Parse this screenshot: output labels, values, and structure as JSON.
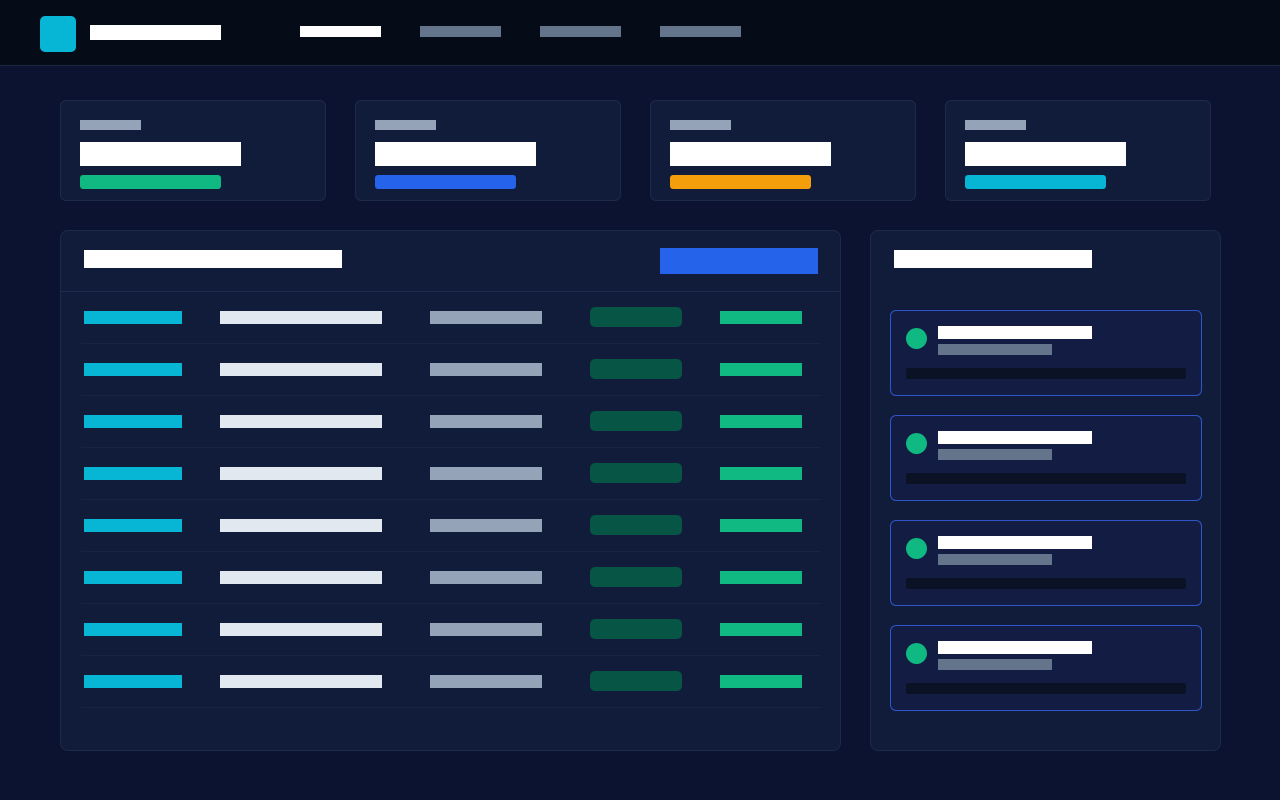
{
  "header": {
    "title": "",
    "nav": [
      {
        "label": ""
      },
      {
        "label": ""
      },
      {
        "label": ""
      },
      {
        "label": ""
      }
    ]
  },
  "colors": {
    "logo": "#06b6d4",
    "nav_inactive": "#64748b",
    "accent_green": "#10b981",
    "accent_blue": "#2563eb",
    "accent_orange": "#f59e0b",
    "accent_cyan": "#06b6d4"
  },
  "stats": [
    {
      "label": "",
      "value": "",
      "accent": "#10b981"
    },
    {
      "label": "",
      "value": "",
      "accent": "#2563eb"
    },
    {
      "label": "",
      "value": "",
      "accent": "#f59e0b"
    },
    {
      "label": "",
      "value": "",
      "accent": "#06b6d4"
    }
  ],
  "table": {
    "title": "",
    "action_label": "",
    "id_color": "#06b6d4",
    "amount_color": "#10b981",
    "rows": [
      {
        "id": "",
        "name": "",
        "meta": "",
        "status": "",
        "amount": ""
      },
      {
        "id": "",
        "name": "",
        "meta": "",
        "status": "",
        "amount": ""
      },
      {
        "id": "",
        "name": "",
        "meta": "",
        "status": "",
        "amount": ""
      },
      {
        "id": "",
        "name": "",
        "meta": "",
        "status": "",
        "amount": ""
      },
      {
        "id": "",
        "name": "",
        "meta": "",
        "status": "",
        "amount": ""
      },
      {
        "id": "",
        "name": "",
        "meta": "",
        "status": "",
        "amount": ""
      },
      {
        "id": "",
        "name": "",
        "meta": "",
        "status": "",
        "amount": ""
      },
      {
        "id": "",
        "name": "",
        "meta": "",
        "status": "",
        "amount": ""
      }
    ]
  },
  "activity": {
    "title": "",
    "dot_color": "#10b981",
    "items": [
      {
        "title": "",
        "subtitle": ""
      },
      {
        "title": "",
        "subtitle": ""
      },
      {
        "title": "",
        "subtitle": ""
      },
      {
        "title": "",
        "subtitle": ""
      }
    ]
  }
}
